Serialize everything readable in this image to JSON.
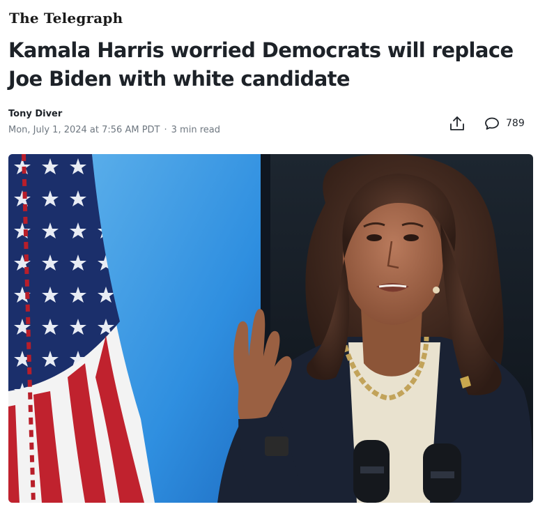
{
  "publisher": {
    "name": "The Telegraph"
  },
  "article": {
    "headline": "Kamala Harris worried Democrats will replace Joe Biden with white candidate",
    "author": "Tony Diver",
    "date": "Mon, July 1, 2024 at 7:56 AM PDT",
    "separator": "·",
    "read_time": "3 min read"
  },
  "actions": {
    "share_icon": "share-icon",
    "comment_icon": "comment-bubble-icon",
    "comment_count": "789"
  },
  "hero_image": {
    "subject": "woman-speaking-at-podium",
    "colors": {
      "blue_backdrop": "#2f8fe0",
      "flag_blue": "#1b2f6b",
      "flag_red": "#c0222e",
      "jacket": "#1a2233"
    }
  }
}
